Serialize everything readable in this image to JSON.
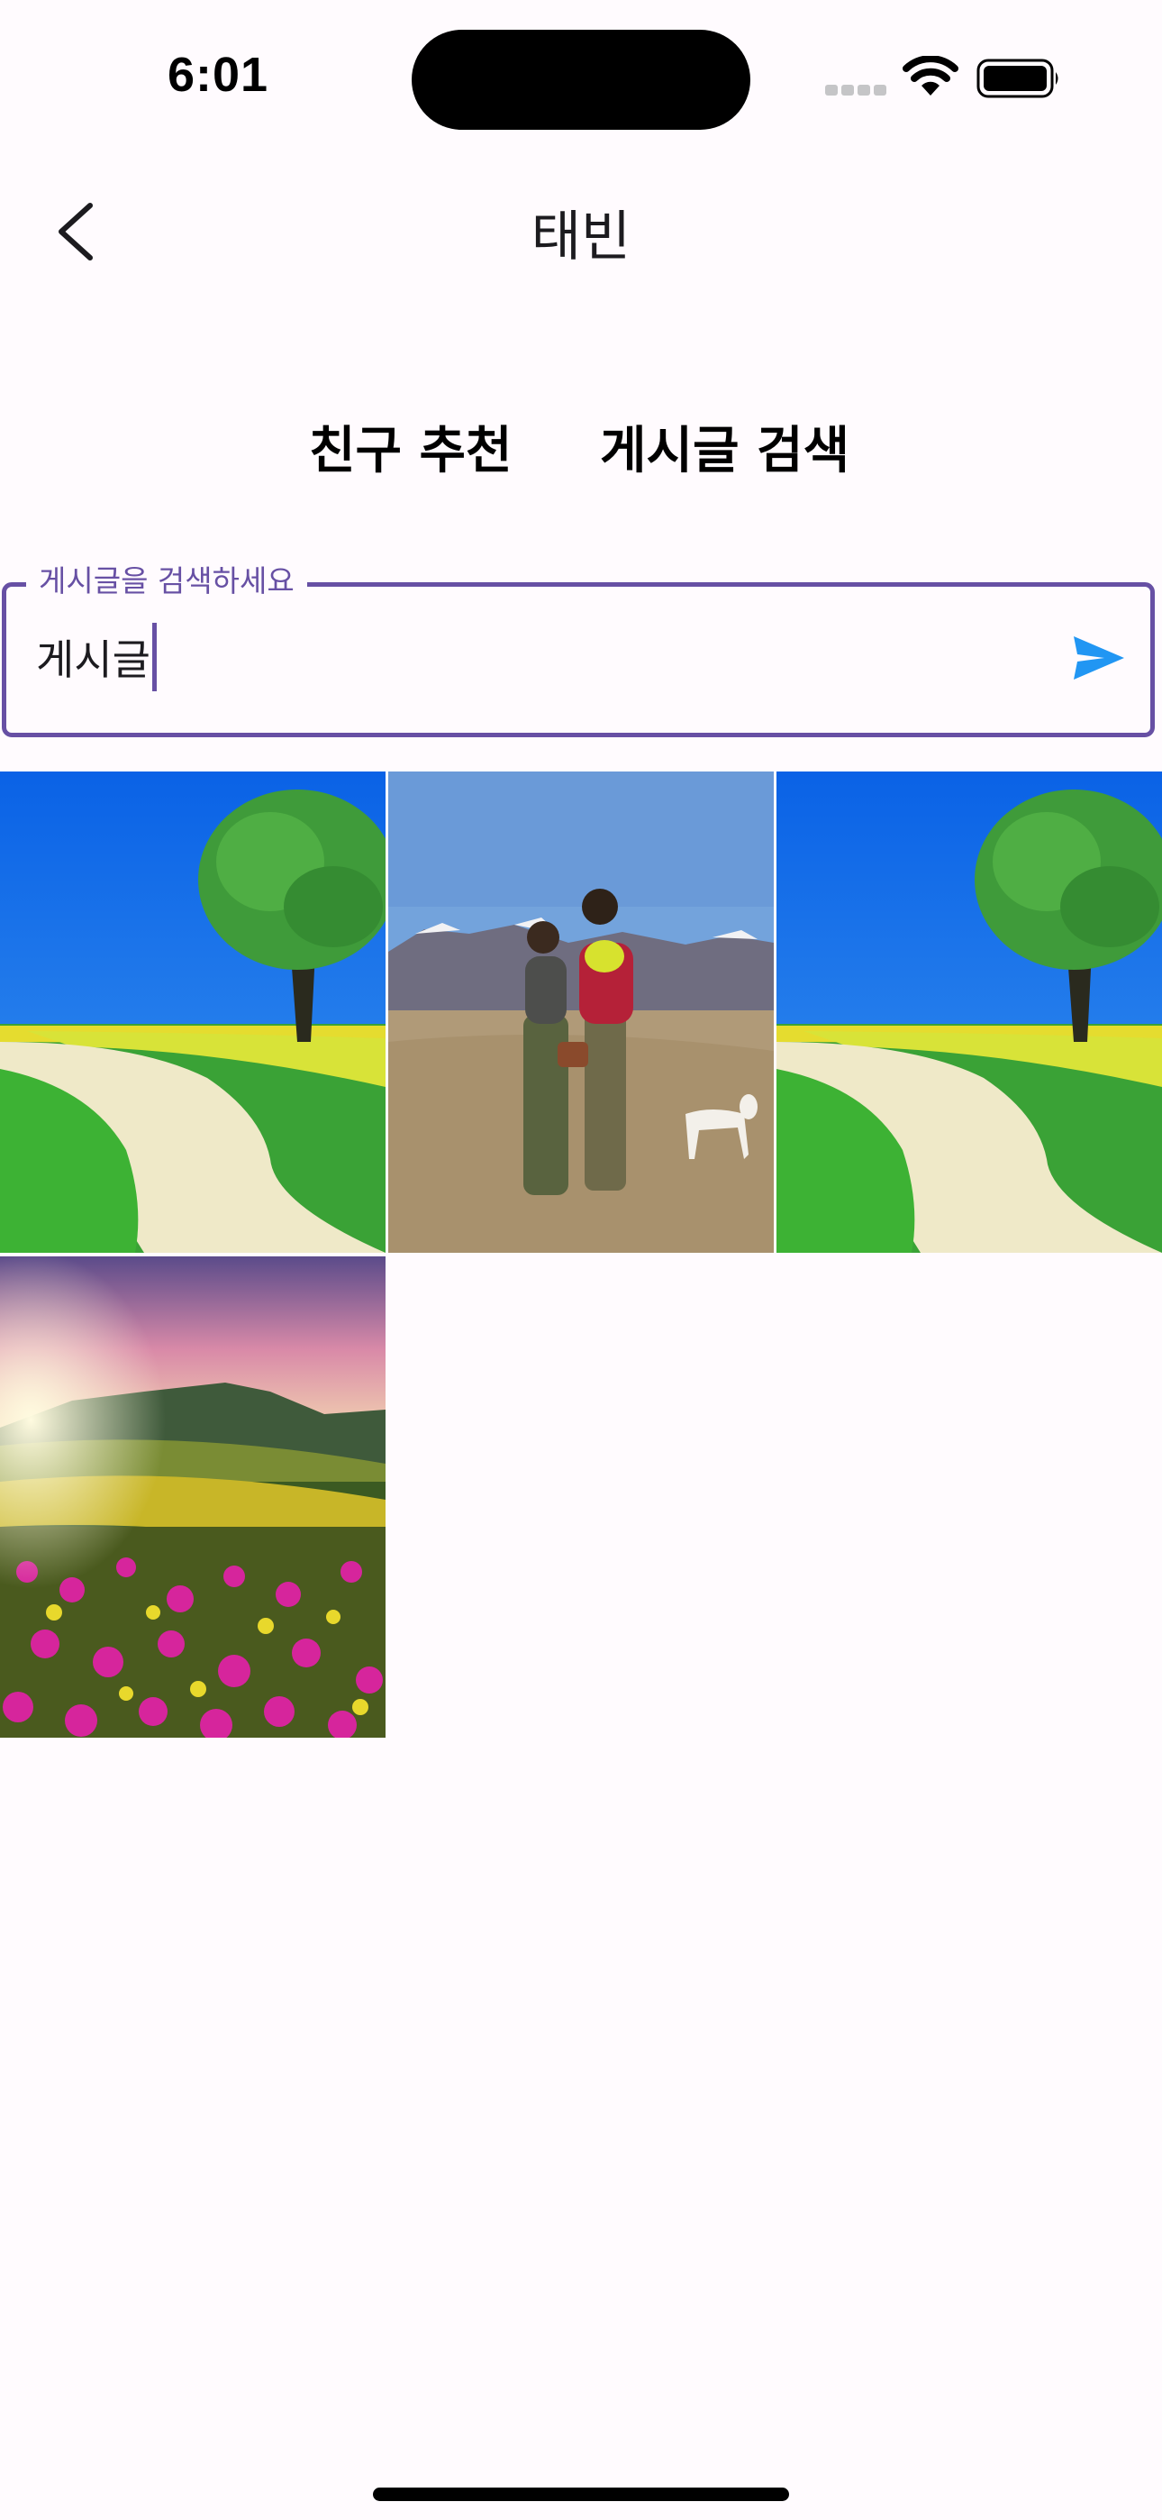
{
  "status_bar": {
    "time": "6:01",
    "icons": [
      "signal-icon",
      "wifi-icon",
      "battery-icon"
    ]
  },
  "app_bar": {
    "back_icon": "chevron-left-icon",
    "title": "태빈"
  },
  "tabs": [
    {
      "label": "친구 추천"
    },
    {
      "label": "게시글 검색"
    }
  ],
  "search": {
    "label": "게시글을 검색하세요",
    "value": "게시글",
    "send_icon": "send-icon",
    "accent_color": "#6750a4",
    "send_color": "#2196f3"
  },
  "results": {
    "posts": [
      {
        "image": "tree-on-meadow-path-image"
      },
      {
        "image": "couple-with-dog-on-mountain-image"
      },
      {
        "image": "tree-on-meadow-path-image"
      },
      {
        "image": "mountain-flower-field-sunset-image"
      }
    ]
  }
}
